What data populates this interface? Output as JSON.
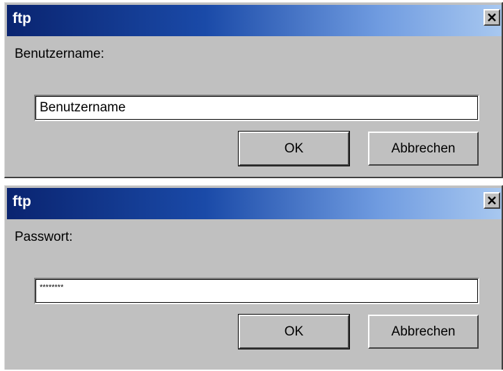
{
  "dialogs": [
    {
      "title": "ftp",
      "label": "Benutzername:",
      "input_value": "Benutzername",
      "ok_label": "OK",
      "cancel_label": "Abbrechen",
      "close_icon": "close-icon"
    },
    {
      "title": "ftp",
      "label": "Passwort:",
      "input_value": "********",
      "ok_label": "OK",
      "cancel_label": "Abbrechen",
      "close_icon": "close-icon"
    }
  ],
  "colors": {
    "dialog_bg": "#c0c0c0",
    "title_start": "#0a2470",
    "title_end": "#a8c8f0",
    "title_text": "#ffffff"
  }
}
